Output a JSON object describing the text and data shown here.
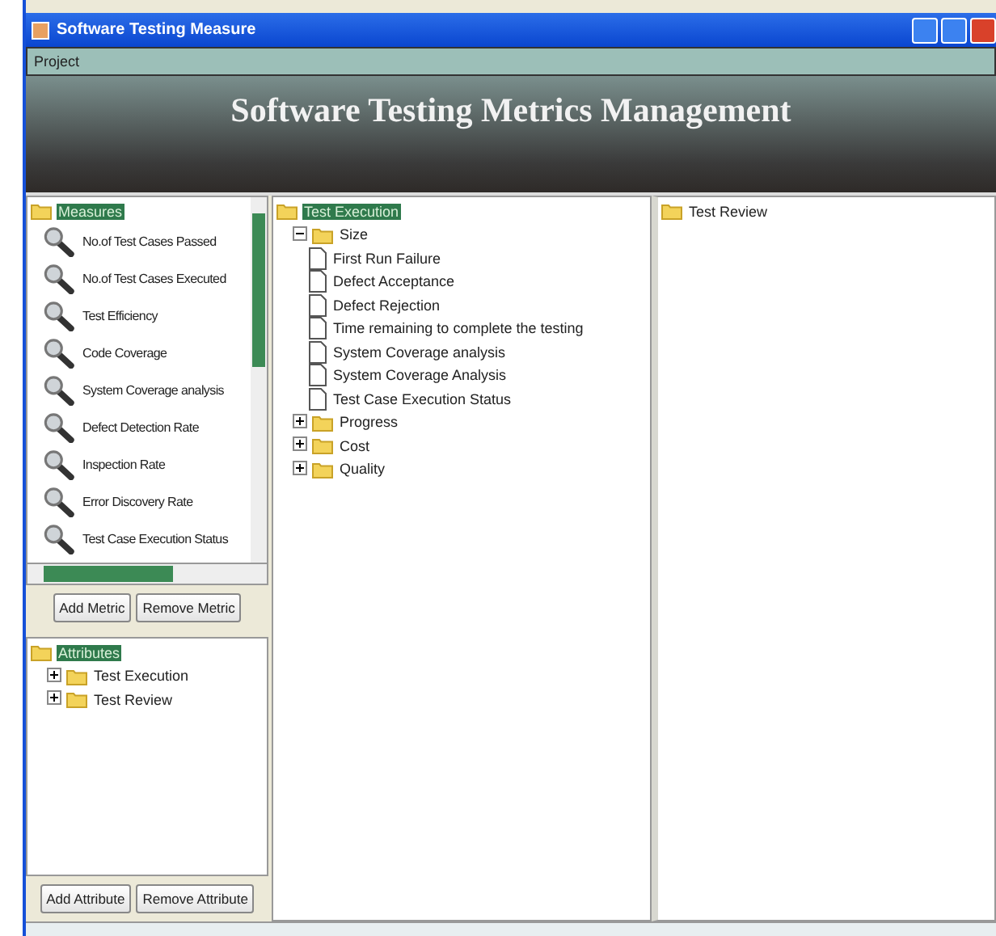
{
  "window": {
    "title": "Software Testing Measure"
  },
  "menu": [
    {
      "label": "Project"
    }
  ],
  "banner": {
    "title": "Software Testing Metrics Management"
  },
  "measures": {
    "root": {
      "label": "Measures",
      "selected": true,
      "children": [
        {
          "label": "No.of Test Cases Passed",
          "kind": "metric",
          "selected": false
        },
        {
          "label": "No.of Test Cases Executed",
          "kind": "metric",
          "selected": false
        },
        {
          "label": "Test Efficiency",
          "kind": "metric",
          "selected": false
        },
        {
          "label": "Code Coverage",
          "kind": "metric",
          "selected": false
        },
        {
          "label": "System Coverage analysis",
          "kind": "metric",
          "selected": false
        },
        {
          "label": "Defect Detection Rate",
          "kind": "metric",
          "selected": false
        },
        {
          "label": "Inspection Rate",
          "kind": "metric",
          "selected": false
        },
        {
          "label": "Error Discovery Rate",
          "kind": "metric",
          "selected": false
        },
        {
          "label": "Test Case Execution Status",
          "kind": "metric",
          "selected": false
        }
      ]
    },
    "buttons": [
      "Add Metric",
      "Remove Metric"
    ]
  },
  "attributes": {
    "root": {
      "label": "Attributes",
      "selected": true,
      "children": [
        {
          "label": "Test Execution",
          "kind": "folder",
          "selected": false,
          "expanded": false
        },
        {
          "label": "Test Review",
          "kind": "folder",
          "selected": false,
          "expanded": false
        }
      ]
    },
    "buttons": [
      "Add Attribute",
      "Remove Attribute"
    ]
  },
  "execution_tree": {
    "root": {
      "label": "Test Execution",
      "selected": true,
      "children": [
        {
          "label": "Size",
          "kind": "folder",
          "selected": false,
          "expanded": true,
          "children": [
            {
              "label": "First Run Failure",
              "kind": "document",
              "selected": false
            },
            {
              "label": "Defect Acceptance",
              "kind": "document",
              "selected": false
            },
            {
              "label": "Defect Rejection",
              "kind": "document",
              "selected": false
            },
            {
              "label": "Time remaining to complete the testing",
              "kind": "document",
              "selected": false
            },
            {
              "label": "System Coverage analysis",
              "kind": "document",
              "selected": false
            },
            {
              "label": "System Coverage Analysis",
              "kind": "document",
              "selected": false
            },
            {
              "label": "Test Case Execution Status",
              "kind": "document",
              "selected": false
            }
          ]
        },
        {
          "label": "Progress",
          "kind": "folder",
          "selected": false,
          "expanded": false
        },
        {
          "label": "Cost",
          "kind": "folder",
          "selected": false,
          "expanded": false
        },
        {
          "label": "Quality",
          "kind": "folder",
          "selected": false,
          "expanded": false
        }
      ]
    }
  },
  "review_tree": {
    "root": {
      "label": "Test Review",
      "selected": false
    }
  }
}
